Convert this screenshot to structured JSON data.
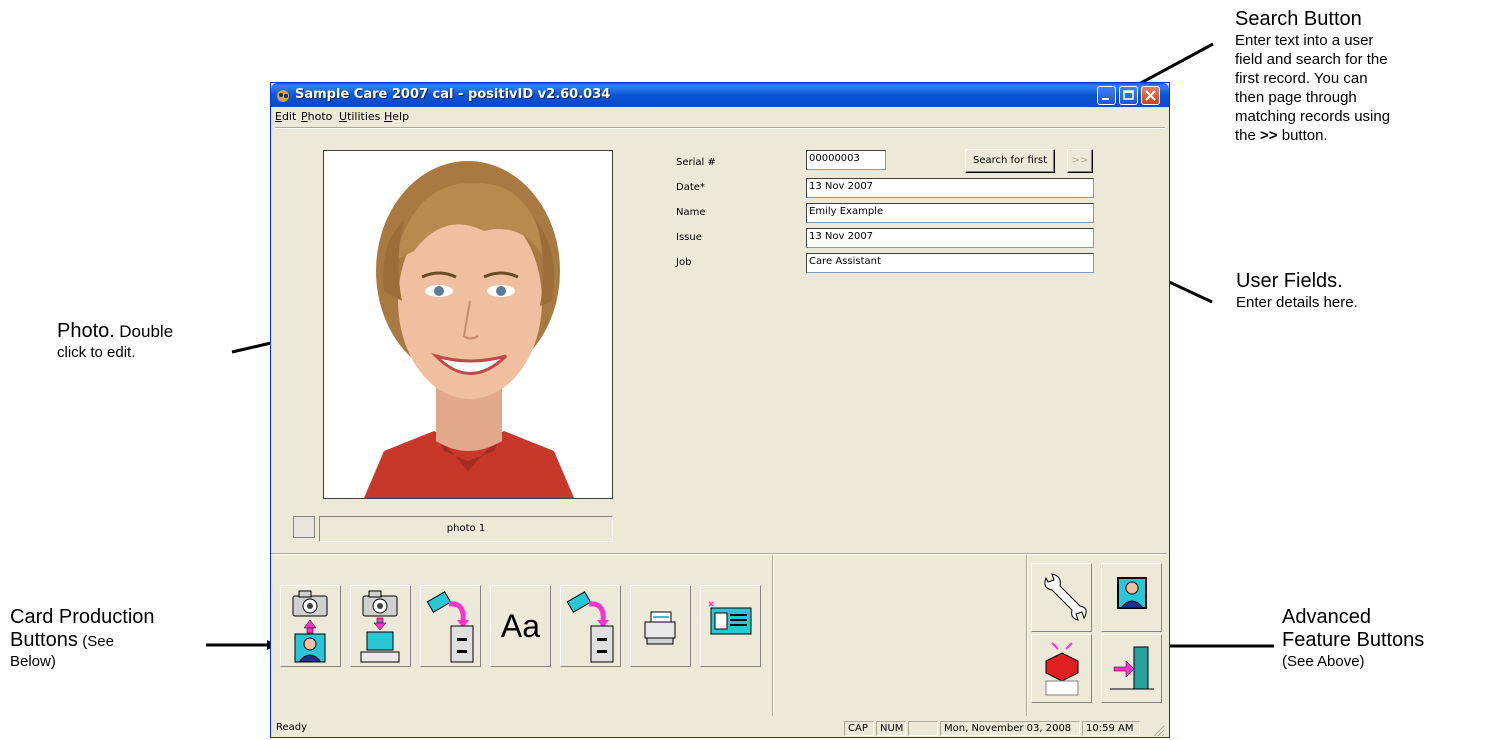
{
  "window": {
    "title": "Sample Care 2007 cal - positivID v2.60.034"
  },
  "menu": [
    {
      "label": "Edit",
      "hotkey": "E"
    },
    {
      "label": "Photo",
      "hotkey": "P"
    },
    {
      "label": "Utilities",
      "hotkey": "U"
    },
    {
      "label": "Help",
      "hotkey": "H"
    }
  ],
  "photo": {
    "label": "photo 1"
  },
  "fields": [
    {
      "label": "Serial #",
      "value": "00000003"
    },
    {
      "label": "Date*",
      "value": "13 Nov 2007"
    },
    {
      "label": "Name",
      "value": "Emily Example"
    },
    {
      "label": "Issue",
      "value": "13 Nov 2007"
    },
    {
      "label": "Job",
      "value": "Care Assistant"
    }
  ],
  "buttons": {
    "search": "Search for first",
    "next": ">>"
  },
  "card_buttons": [
    {
      "icon": "camera-to-card-icon"
    },
    {
      "icon": "camera-to-computer-icon"
    },
    {
      "icon": "card-to-file-icon"
    },
    {
      "icon": "font-icon",
      "text": "Aa"
    },
    {
      "icon": "card-from-file-icon"
    },
    {
      "icon": "printer-icon"
    },
    {
      "icon": "card-layout-icon"
    }
  ],
  "advanced_buttons": [
    {
      "icon": "wrench-icon"
    },
    {
      "icon": "user-photo-icon"
    },
    {
      "icon": "database-transfer-icon"
    },
    {
      "icon": "exit-door-icon"
    }
  ],
  "status": {
    "left": "Ready",
    "cap": "CAP",
    "num": "NUM",
    "date": "Mon, November 03, 2008",
    "time": "10:59 AM"
  },
  "annotations": {
    "search_title": "Search Button",
    "search_desc": [
      "Enter text into a user",
      "field and search for the",
      "first record.  You can",
      "then page through",
      "matching records using"
    ],
    "search_desc_last_bold": ">>",
    "search_desc_last_rest": " button.",
    "fields_title": "User Fields.",
    "fields_desc": "Enter details here.",
    "photo_title": "Photo.",
    "photo_title_rest": "Double",
    "photo_desc": "click to edit.",
    "card_title_1": "Card Production",
    "card_title_2": "Buttons",
    "card_title_2_small": "(See",
    "card_title_3": "Below)",
    "adv_title_1": "Advanced",
    "adv_title_2": "Feature Buttons",
    "adv_desc": "(See Above)"
  },
  "colors": {
    "window_bg": "#ece9d8",
    "titlebar": "#0a5fd8",
    "arrow": "#000000"
  }
}
